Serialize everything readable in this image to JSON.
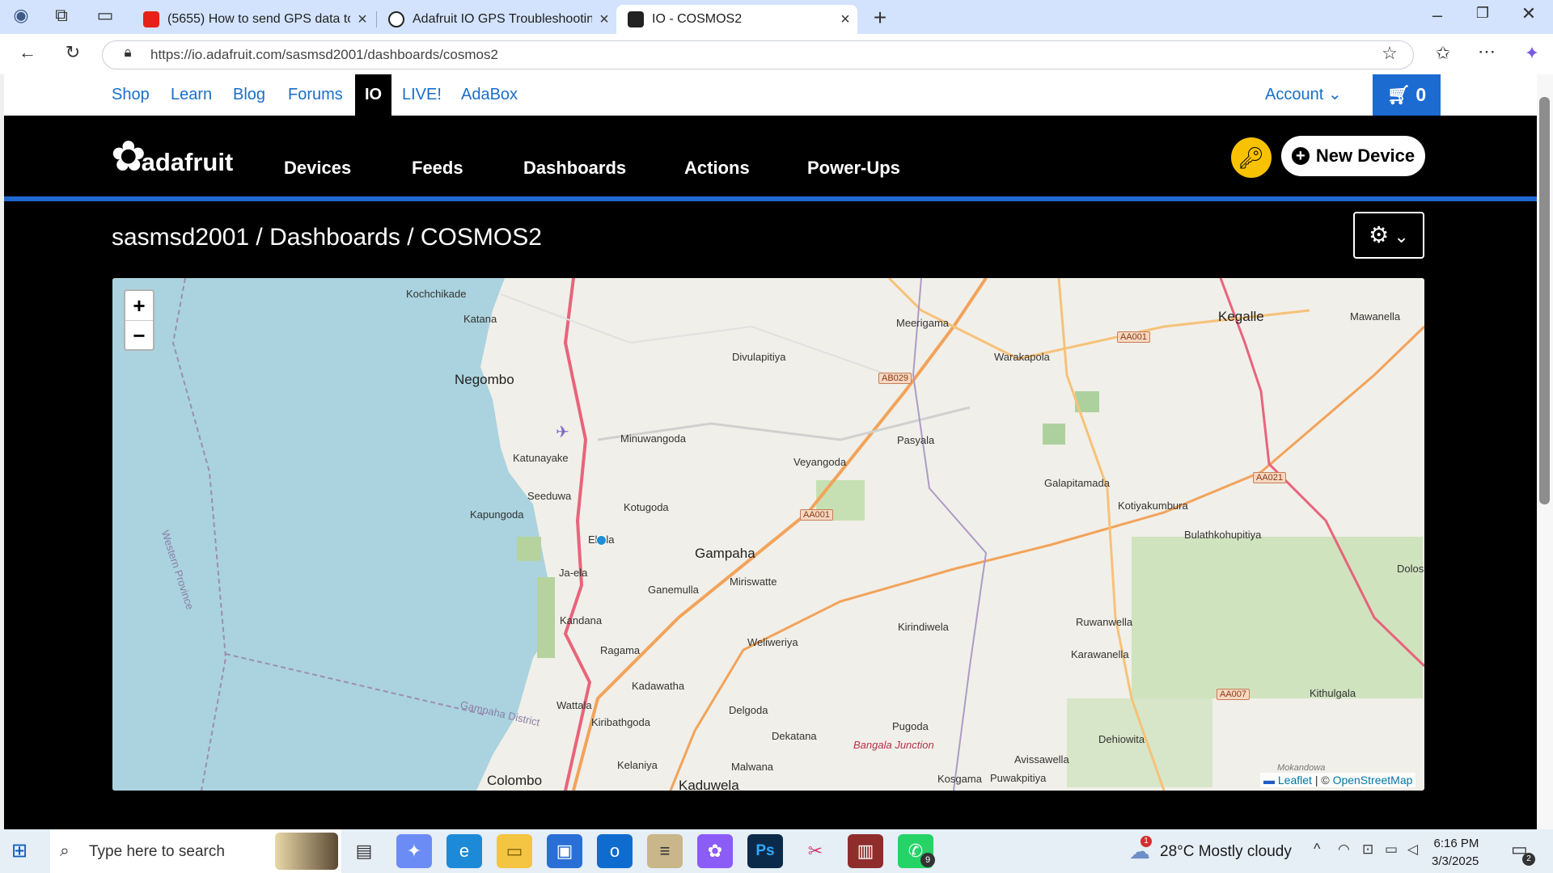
{
  "browser": {
    "tabs": [
      {
        "title": "(5655) How to send GPS data to A",
        "favicon": "youtube-icon"
      },
      {
        "title": "Adafruit IO GPS Troubleshooting",
        "favicon": "chatgpt-icon"
      },
      {
        "title": "IO - COSMOS2",
        "favicon": "adafruit-icon"
      }
    ],
    "url": "https://io.adafruit.com/sasmsd2001/dashboards/cosmos2"
  },
  "topnav": {
    "links": [
      "Shop",
      "Learn",
      "Blog",
      "Forums",
      "IO",
      "LIVE!",
      "AdaBox"
    ],
    "account": "Account",
    "cart_count": "0"
  },
  "mainnav": {
    "logo": "adafruit",
    "items": [
      "Devices",
      "Feeds",
      "Dashboards",
      "Actions",
      "Power-Ups"
    ],
    "new_device": "New Device"
  },
  "breadcrumb": "sasmsd2001 / Dashboards / COSMOS2",
  "map": {
    "zoom_in": "+",
    "zoom_out": "−",
    "attribution_leaflet": "Leaflet",
    "attribution_sep": " | © ",
    "attribution_osm": "OpenStreetMap",
    "places": {
      "kochchikade": "Kochchikade",
      "katana": "Katana",
      "negombo": "Negombo",
      "meerigama": "Meerigama",
      "kegalle": "Kegalle",
      "mawanella": "Mawanella",
      "divulapitiya": "Divulapitiya",
      "warakapola": "Warakapola",
      "minuwangoda": "Minuwangoda",
      "katunayake": "Katunayake",
      "pasyala": "Pasyala",
      "veyangoda": "Veyangoda",
      "seeduwa": "Seeduwa",
      "galapitamada": "Galapitamada",
      "kapungoda": "Kapungoda",
      "kotugoda": "Kotugoda",
      "kotiyakumbura": "Kotiyakumbura",
      "ekala": "Ekala",
      "gampaha": "Gampaha",
      "bulathkohupitiya": "Bulathkohupitiya",
      "dolos": "Dolos",
      "jaela": "Ja-ela",
      "ganemulla": "Ganemulla",
      "miriswatte": "Miriswatte",
      "kandana": "Kandana",
      "kirindiwela": "Kirindiwela",
      "ruwanwella": "Ruwanwella",
      "ragama": "Ragama",
      "weliweriya": "Weliweriya",
      "karawanella": "Karawanella",
      "kadawatha": "Kadawatha",
      "kithulgala": "Kithulgala",
      "wattala": "Wattala",
      "delgoda": "Delgoda",
      "kiribathgoda": "Kiribathgoda",
      "pugoda": "Pugoda",
      "dekatana": "Dekatana",
      "bangala": "Bangala Junction",
      "dehiowita": "Dehiowita",
      "avissawella": "Avissawella",
      "kelaniya": "Kelaniya",
      "malwana": "Malwana",
      "kosgama": "Kosgama",
      "puwakpitiya": "Puwakpitiya",
      "colombo": "Colombo",
      "kaduwela": "Kaduwela",
      "western": "Western Province",
      "gampahadist": "Gampaha District",
      "mokandowa": "Mokandowa"
    },
    "highways": {
      "aa001a": "AA001",
      "ab029": "AB029",
      "aa021": "AA021",
      "aa001b": "AA001",
      "aa007": "AA007"
    }
  },
  "taskbar": {
    "search_placeholder": "Type here to search",
    "weather": "28°C  Mostly cloudy",
    "time": "6:16 PM",
    "date": "3/3/2025",
    "notification_count": "2",
    "whatsapp_badge": "9",
    "weather_badge": "1"
  }
}
